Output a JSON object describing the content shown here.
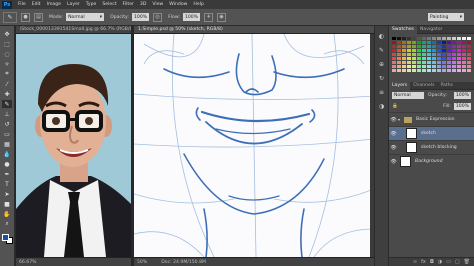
{
  "app": {
    "logo": "Ps"
  },
  "menu": [
    "File",
    "Edit",
    "Image",
    "Layer",
    "Type",
    "Select",
    "Filter",
    "3D",
    "View",
    "Window",
    "Help"
  ],
  "options": {
    "tool_icon": "brush-icon",
    "mode_label": "Mode:",
    "mode_value": "Normal",
    "opacity_label": "Opacity:",
    "opacity_value": "100%",
    "flow_label": "Flow:",
    "flow_value": "100%",
    "workspace": "Painting"
  },
  "tools": [
    "move-tool",
    "marquee-tool",
    "lasso-tool",
    "quick-select-tool",
    "crop-tool",
    "eyedropper-tool",
    "healing-tool",
    "brush-tool",
    "stamp-tool",
    "history-brush-tool",
    "eraser-tool",
    "gradient-tool",
    "blur-tool",
    "dodge-tool",
    "pen-tool",
    "type-tool",
    "path-select-tool",
    "shape-tool",
    "hand-tool",
    "zoom-tool"
  ],
  "colors": {
    "foreground": "#1a4fa8",
    "background": "#ffffff",
    "sketch_line": "#3d6fb8"
  },
  "doc1": {
    "tab": "iStock_000013391541Small.jpg @ 66.7% (RGB/8)",
    "zoom": "66.67%"
  },
  "doc2": {
    "tab": "1.Simple.psd @ 50% (sketch, RGB/8)",
    "zoom": "50%",
    "doc_size": "Doc: 24.9M/150.8M"
  },
  "panels": {
    "top_tabs": [
      "Swatches",
      "Navigator"
    ],
    "layer_tabs": [
      "Layers",
      "Channels",
      "Paths"
    ],
    "blend_mode": "Normal",
    "opacity_label": "Opacity:",
    "opacity_value": "100%",
    "fill_label": "Fill:",
    "fill_value": "100%",
    "layers": [
      {
        "name": "Basic Expression",
        "type": "group",
        "selected": false
      },
      {
        "name": "sketch",
        "type": "layer",
        "selected": true
      },
      {
        "name": "sketch blocking",
        "type": "layer",
        "selected": false
      },
      {
        "name": "Background",
        "type": "layer",
        "selected": false
      }
    ]
  }
}
